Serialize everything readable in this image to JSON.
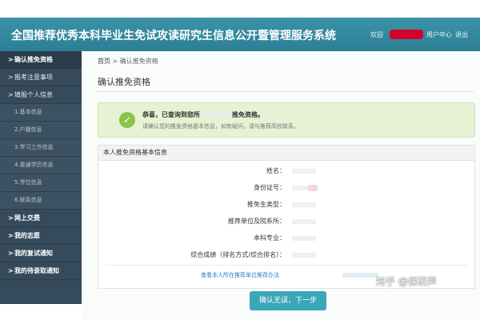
{
  "header": {
    "title": "全国推荐优秀本科毕业生免试攻读研究生信息公开暨管理服务系统",
    "welcome": "欢迎",
    "user_center": "用户中心",
    "exit": "退出"
  },
  "sidebar": {
    "items": [
      {
        "label": "确认推免资格",
        "chevron": ">"
      },
      {
        "label": "报考注意事项",
        "chevron": ">"
      },
      {
        "label": "填报个人信息",
        "chevron": ">"
      },
      {
        "label": "1.基本信息"
      },
      {
        "label": "2.户籍信息"
      },
      {
        "label": "3.学习工作信息"
      },
      {
        "label": "4.普通学历信息"
      },
      {
        "label": "5.学位信息"
      },
      {
        "label": "6.联系信息"
      },
      {
        "label": "网上交费",
        "chevron": ">"
      },
      {
        "label": "我的志愿",
        "chevron": ">"
      },
      {
        "label": "我的复试通知",
        "chevron": ">"
      },
      {
        "label": "我的待录取通知",
        "chevron": ">"
      }
    ]
  },
  "main": {
    "breadcrumb": {
      "home": "首页",
      "separator": ">",
      "current": "确认推免资格"
    },
    "page_title": "确认推免资格",
    "notice": {
      "icon": "check-icon",
      "msg_prefix": "恭喜，已查询到您所",
      "msg_suffix": "推免资格。",
      "sub": "请确认您的推免资格基本信息，如有疑问，请与推荐高校联系。"
    },
    "panel": {
      "heading": "本人推免资格基本信息",
      "fields": [
        {
          "label": "姓名："
        },
        {
          "label": "身份证号："
        },
        {
          "label": "推免生类型："
        },
        {
          "label": "推荐单位及院系所："
        },
        {
          "label": "本科专业："
        },
        {
          "label": "综合成绩（排名方式/综合排名）："
        }
      ],
      "link": "查看本人所在推荐单位推荐办法"
    },
    "confirm_button": "确认无误，下一步"
  },
  "watermark": "知乎 @保研声"
}
